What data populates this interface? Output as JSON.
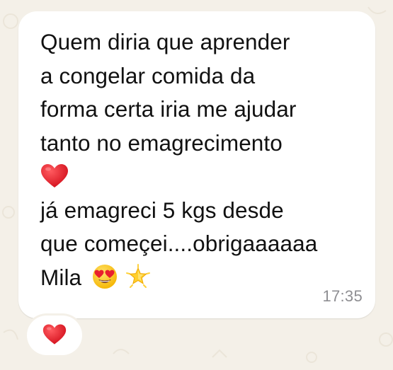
{
  "message": {
    "lines": [
      "Quem diria que aprender",
      "a congelar comida da",
      "forma certa iria me ajudar",
      "tanto no emagrecimento",
      "",
      "já emagreci 5 kgs desde",
      "que começei....obrigaaaaaa",
      "Mila"
    ],
    "timestamp": "17:35"
  },
  "reaction": {
    "icon": "red-heart-icon"
  },
  "colors": {
    "background": "#f4f0e8",
    "bubble": "#ffffff",
    "text": "#111111",
    "timestamp": "#8e8e92",
    "heart": "#e8202e"
  }
}
